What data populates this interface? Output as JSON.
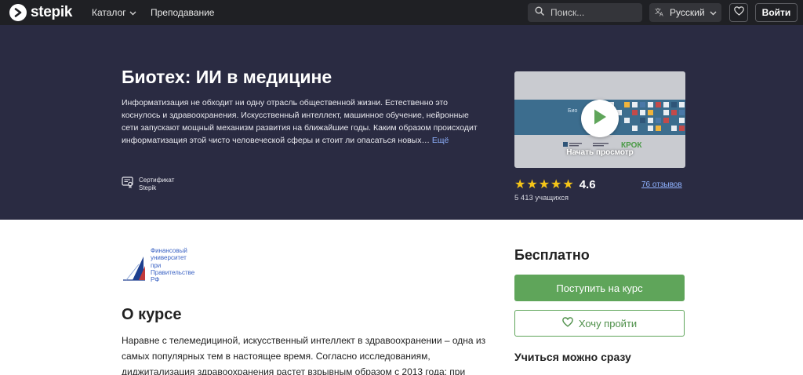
{
  "header": {
    "logo_text": "stepik",
    "nav": {
      "catalog": "Каталог",
      "teaching": "Преподавание"
    },
    "search": {
      "placeholder": "Поиск..."
    },
    "language": "Русский",
    "login": "Войти"
  },
  "hero": {
    "title": "Биотех: ИИ в медицине",
    "description": "Информатизация не обходит ни одну отрасль общественной жизни. Естественно это коснулось и здравоохранения. Искусственный интеллект, машинное обучение, нейронные сети запускают мощный механизм развития на ближайшие годы. Каким образом происходит информатизация этой чисто человеческой сферы и стоит ли опасаться новых…",
    "more_link": "Ещё",
    "certificate": {
      "line1": "Сертификат",
      "line2": "Stepik"
    },
    "video": {
      "label": "Начать просмотр",
      "caption": "Био",
      "partner": "КРОК"
    },
    "rating": {
      "value": "4.6",
      "stars": 4.6
    },
    "reviews": "76 отзывов",
    "learners": "5 413 учащихся"
  },
  "organization": {
    "name_lines": [
      "Финансовый",
      "университет",
      "при",
      "Правительстве",
      "РФ"
    ]
  },
  "about": {
    "title": "О курсе",
    "text": "Наравне с телемедициной, искусственный интеллект в здравоохранении – одна из самых популярных тем в настоящее время. Согласно исследованиям, диджитализация здравоохранения растет взрывным образом с 2013 года; при"
  },
  "sidebar": {
    "price": "Бесплатно",
    "enroll": "Поступить на курс",
    "wishlist": "Хочу пройти",
    "start_now": "Учиться можно сразу"
  },
  "colors": {
    "topbar": "#1f2024",
    "hero": "#2a2b42",
    "accent_green": "#5fa55a",
    "link_blue": "#8fb2ff",
    "star": "#f5c518"
  }
}
